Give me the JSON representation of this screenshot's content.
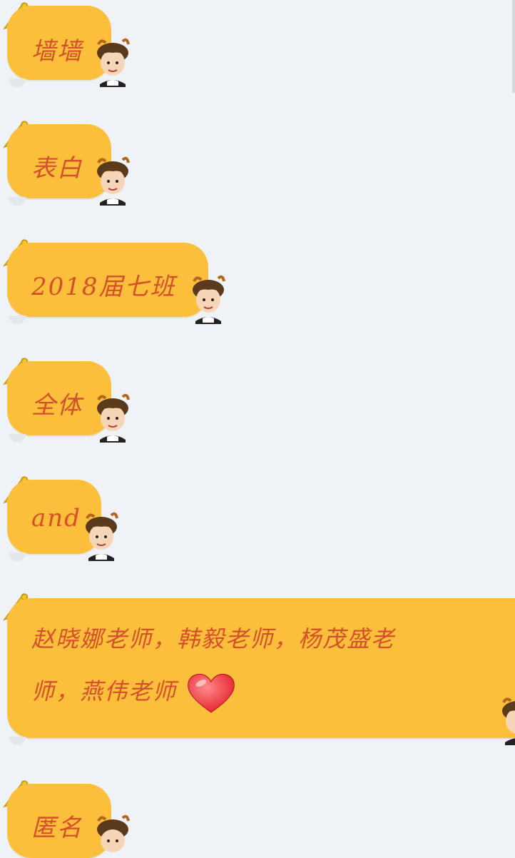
{
  "messages": [
    {
      "text": "墙墙"
    },
    {
      "text": "表白"
    },
    {
      "text": "2018届七班"
    },
    {
      "text": "全体"
    },
    {
      "text": "and"
    },
    {
      "line1": "赵晓娜老师，韩毅老师，杨茂盛老",
      "line2": "师，燕伟老师",
      "emoji": "red-heart-icon"
    },
    {
      "text": "匿名"
    }
  ],
  "colors": {
    "bubble": "#fcbf3c",
    "text": "#d5502a",
    "background": "#eff2f6"
  }
}
